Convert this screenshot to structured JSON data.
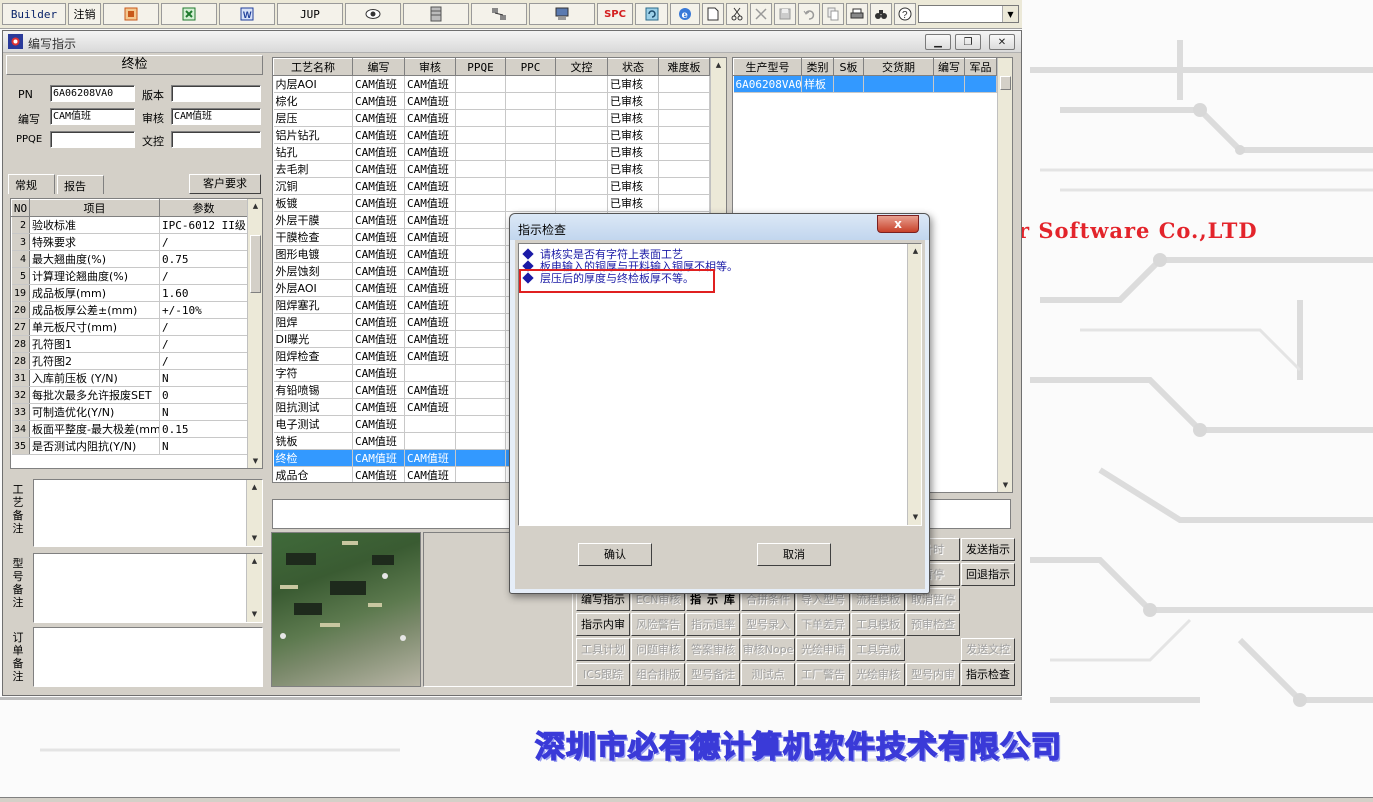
{
  "toolbar": {
    "builder_label": "Builder",
    "logout_label": "注销",
    "jup_label": "JUP",
    "spc_label": "SPC",
    "combo_value": ""
  },
  "bg": {
    "company_en": "r Software Co.,LTD",
    "company_zh": "深圳市必有德计算机软件技术有限公司"
  },
  "window": {
    "title": "编写指示"
  },
  "left": {
    "section_title": "终检",
    "pn_label": "PN",
    "pn_value": "6A06208VA0",
    "version_label": "版本",
    "version_value": "",
    "writer_label": "编写",
    "writer_value": "CAM值班",
    "reviewer_label": "审核",
    "reviewer_value": "CAM值班",
    "ppqe_label": "PPQE",
    "ppqe_value": "",
    "doc_label": "文控",
    "doc_value": "",
    "tabs": [
      "常规",
      "报告"
    ],
    "customer_btn": "客户要求",
    "grid_headers": [
      "NO",
      "项目",
      "参数"
    ],
    "grid_rows": [
      {
        "no": "2",
        "item": "验收标准",
        "param": "IPC-6012 II级"
      },
      {
        "no": "3",
        "item": "特殊要求",
        "param": "/"
      },
      {
        "no": "4",
        "item": "最大翘曲度(%)",
        "param": "0.75"
      },
      {
        "no": "5",
        "item": "计算理论翘曲度(%)",
        "param": "/"
      },
      {
        "no": "19",
        "item": "成品板厚(mm)",
        "param": "1.60"
      },
      {
        "no": "20",
        "item": "成品板厚公差±(mm)",
        "param": "+/-10%"
      },
      {
        "no": "27",
        "item": "单元板尺寸(mm)",
        "param": "/"
      },
      {
        "no": "28",
        "item": "孔符图1",
        "param": "/"
      },
      {
        "no": "28",
        "item": "孔符图2",
        "param": "/"
      },
      {
        "no": "31",
        "item": "入库前压板 (Y/N)",
        "param": "N"
      },
      {
        "no": "32",
        "item": "每批次最多允许报废SET",
        "param": "0"
      },
      {
        "no": "33",
        "item": "可制造优化(Y/N)",
        "param": "N"
      },
      {
        "no": "34",
        "item": "板面平整度-最大极差(mm)",
        "param": "0.15"
      },
      {
        "no": "35",
        "item": "是否测试内阻抗(Y/N)",
        "param": "N"
      }
    ],
    "memo_labels": [
      "工艺备注",
      "型号备注",
      "订单备注"
    ]
  },
  "process": {
    "headers": [
      "工艺名称",
      "编写",
      "审核",
      "PPQE",
      "PPC",
      "文控",
      "状态",
      "难度板"
    ],
    "rows": [
      {
        "name": "内层AOI",
        "writer": "CAM值班",
        "reviewer": "CAM值班",
        "status": "已审核"
      },
      {
        "name": "棕化",
        "writer": "CAM值班",
        "reviewer": "CAM值班",
        "status": "已审核"
      },
      {
        "name": "层压",
        "writer": "CAM值班",
        "reviewer": "CAM值班",
        "status": "已审核"
      },
      {
        "name": "铝片钻孔",
        "writer": "CAM值班",
        "reviewer": "CAM值班",
        "status": "已审核"
      },
      {
        "name": "钻孔",
        "writer": "CAM值班",
        "reviewer": "CAM值班",
        "status": "已审核"
      },
      {
        "name": "去毛刺",
        "writer": "CAM值班",
        "reviewer": "CAM值班",
        "status": "已审核"
      },
      {
        "name": "沉铜",
        "writer": "CAM值班",
        "reviewer": "CAM值班",
        "status": "已审核"
      },
      {
        "name": "板镀",
        "writer": "CAM值班",
        "reviewer": "CAM值班",
        "status": "已审核"
      },
      {
        "name": "外层干膜",
        "writer": "CAM值班",
        "reviewer": "CAM值班",
        "status": ""
      },
      {
        "name": "干膜检查",
        "writer": "CAM值班",
        "reviewer": "CAM值班",
        "status": ""
      },
      {
        "name": "图形电镀",
        "writer": "CAM值班",
        "reviewer": "CAM值班",
        "status": ""
      },
      {
        "name": "外层蚀刻",
        "writer": "CAM值班",
        "reviewer": "CAM值班",
        "status": ""
      },
      {
        "name": "外层AOI",
        "writer": "CAM值班",
        "reviewer": "CAM值班",
        "status": ""
      },
      {
        "name": "阻焊塞孔",
        "writer": "CAM值班",
        "reviewer": "CAM值班",
        "status": ""
      },
      {
        "name": "阻焊",
        "writer": "CAM值班",
        "reviewer": "CAM值班",
        "status": ""
      },
      {
        "name": "DI曝光",
        "writer": "CAM值班",
        "reviewer": "CAM值班",
        "status": ""
      },
      {
        "name": "阻焊检查",
        "writer": "CAM值班",
        "reviewer": "CAM值班",
        "status": ""
      },
      {
        "name": "字符",
        "writer": "CAM值班",
        "reviewer": "",
        "status": ""
      },
      {
        "name": "有铅喷锡",
        "writer": "CAM值班",
        "reviewer": "CAM值班",
        "status": ""
      },
      {
        "name": "阻抗测试",
        "writer": "CAM值班",
        "reviewer": "CAM值班",
        "status": ""
      },
      {
        "name": "电子测试",
        "writer": "CAM值班",
        "reviewer": "",
        "status": ""
      },
      {
        "name": "铣板",
        "writer": "CAM值班",
        "reviewer": "",
        "status": ""
      },
      {
        "name": "终检",
        "writer": "CAM值班",
        "reviewer": "CAM值班",
        "status": "",
        "selected": true
      },
      {
        "name": "成品仓",
        "writer": "CAM值班",
        "reviewer": "CAM值班",
        "status": ""
      }
    ]
  },
  "product": {
    "headers": [
      "生产型号",
      "类别",
      "S板",
      "交货期",
      "编写",
      "军品"
    ],
    "rows": [
      {
        "model": "6A06208VA0",
        "category": "样板",
        "sboard": "",
        "due": "",
        "writer": "",
        "military": "",
        "selected": true
      }
    ]
  },
  "actions": [
    {
      "label": "计时",
      "row": 0,
      "col": 6,
      "disabled": true
    },
    {
      "label": "发送指示",
      "row": 0,
      "col": 7,
      "disabled": false
    },
    {
      "label": "暂停",
      "row": 1,
      "col": 6,
      "disabled": true
    },
    {
      "label": "回退指示",
      "row": 1,
      "col": 7,
      "disabled": false
    },
    {
      "label": "编写指示",
      "row": 2,
      "col": 0,
      "disabled": false
    },
    {
      "label": "ECN审核",
      "row": 2,
      "col": 1,
      "disabled": true
    },
    {
      "label": "指 示 库",
      "row": 2,
      "col": 2,
      "disabled": false,
      "wide": true
    },
    {
      "label": "合拼条件",
      "row": 2,
      "col": 3,
      "disabled": true
    },
    {
      "label": "导入型号",
      "row": 2,
      "col": 4,
      "disabled": true
    },
    {
      "label": "流程模板",
      "row": 2,
      "col": 5,
      "disabled": true
    },
    {
      "label": "取消暂停",
      "row": 2,
      "col": 6,
      "disabled": true
    },
    {
      "label": "指示内审",
      "row": 3,
      "col": 0,
      "disabled": false
    },
    {
      "label": "风险警告",
      "row": 3,
      "col": 1,
      "disabled": true
    },
    {
      "label": "指示退率",
      "row": 3,
      "col": 2,
      "disabled": true
    },
    {
      "label": "型号录入",
      "row": 3,
      "col": 3,
      "disabled": true
    },
    {
      "label": "下单差异",
      "row": 3,
      "col": 4,
      "disabled": true
    },
    {
      "label": "工具模板",
      "row": 3,
      "col": 5,
      "disabled": true
    },
    {
      "label": "预审检查",
      "row": 3,
      "col": 6,
      "disabled": true
    },
    {
      "label": "工具计划",
      "row": 4,
      "col": 0,
      "disabled": true
    },
    {
      "label": "问题审核",
      "row": 4,
      "col": 1,
      "disabled": true
    },
    {
      "label": "答案审核",
      "row": 4,
      "col": 2,
      "disabled": true
    },
    {
      "label": "审核Nope",
      "row": 4,
      "col": 3,
      "disabled": true
    },
    {
      "label": "光绘申请",
      "row": 4,
      "col": 4,
      "disabled": true
    },
    {
      "label": "工具完成",
      "row": 4,
      "col": 5,
      "disabled": true
    },
    {
      "label": "发送文控",
      "row": 4,
      "col": 7,
      "disabled": true
    },
    {
      "label": "ICS跟踪",
      "row": 5,
      "col": 0,
      "disabled": true
    },
    {
      "label": "组合排版",
      "row": 5,
      "col": 1,
      "disabled": true
    },
    {
      "label": "型号备注",
      "row": 5,
      "col": 2,
      "disabled": true
    },
    {
      "label": "测试点",
      "row": 5,
      "col": 3,
      "disabled": true
    },
    {
      "label": "工厂警告",
      "row": 5,
      "col": 4,
      "disabled": true
    },
    {
      "label": "光绘审核",
      "row": 5,
      "col": 5,
      "disabled": true
    },
    {
      "label": "型号内审",
      "row": 5,
      "col": 6,
      "disabled": true
    },
    {
      "label": "指示检查",
      "row": 5,
      "col": 7,
      "disabled": false
    }
  ],
  "dialog": {
    "title": "指示检查",
    "close_label": "x",
    "messages": [
      "请核实是否有字符上表面工艺",
      "板电输入的铜厚与开料输入铜厚不相等。",
      "层压后的厚度与终检板厚不等。"
    ],
    "ok_label": "确认",
    "cancel_label": "取消"
  }
}
